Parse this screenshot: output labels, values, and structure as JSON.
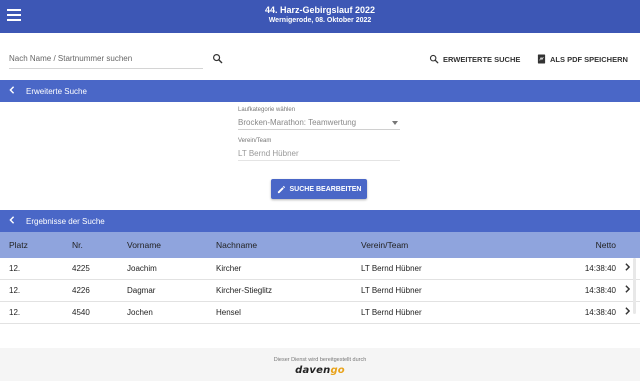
{
  "header": {
    "title": "44. Harz-Gebirgslauf 2022",
    "subtitle": "Wernigerode, 08. Oktober 2022"
  },
  "search": {
    "placeholder": "Nach Name / Startnummer suchen",
    "value": ""
  },
  "toolbar": {
    "extended_search_label": "ERWEITERTE SUCHE",
    "pdf_label": "ALS PDF SPEICHERN"
  },
  "extended_section": {
    "title": "Erweiterte Suche",
    "category_label": "Laufkategorie wählen",
    "category_value": "Brocken-Marathon: Teamwertung",
    "team_label": "Verein/Team",
    "team_value": "LT Bernd Hübner",
    "edit_button_label": "SUCHE BEARBEITEN"
  },
  "results_section": {
    "title": "Ergebnisse der Suche",
    "columns": {
      "platz": "Platz",
      "nr": "Nr.",
      "vorname": "Vorname",
      "nachname": "Nachname",
      "verein": "Verein/Team",
      "netto": "Netto"
    },
    "rows": [
      {
        "platz": "12.",
        "nr": "4225",
        "vorname": "Joachim",
        "nachname": "Kircher",
        "verein": "LT Bernd Hübner",
        "netto": "14:38:40"
      },
      {
        "platz": "12.",
        "nr": "4226",
        "vorname": "Dagmar",
        "nachname": "Kircher-Stieglitz",
        "verein": "LT Bernd Hübner",
        "netto": "14:38:40"
      },
      {
        "platz": "12.",
        "nr": "4540",
        "vorname": "Jochen",
        "nachname": "Hensel",
        "verein": "LT Bernd Hübner",
        "netto": "14:38:40"
      }
    ]
  },
  "footer": {
    "text": "Dieser Dienst wird bereitgestellt durch",
    "logo_main": "daven",
    "logo_accent": "go"
  },
  "colors": {
    "header_bg": "#3d57b5",
    "section_bg": "#4a67c7",
    "table_header_bg": "#8fa4dd",
    "logo_accent": "#e8a21a"
  },
  "icons": {
    "menu": "hamburger-menu-icon",
    "search": "search-icon",
    "extended_search": "magnify-icon",
    "pdf": "pdf-file-icon",
    "back": "chevron-left-icon",
    "edit": "pencil-icon",
    "row_detail": "chevron-right-icon"
  }
}
